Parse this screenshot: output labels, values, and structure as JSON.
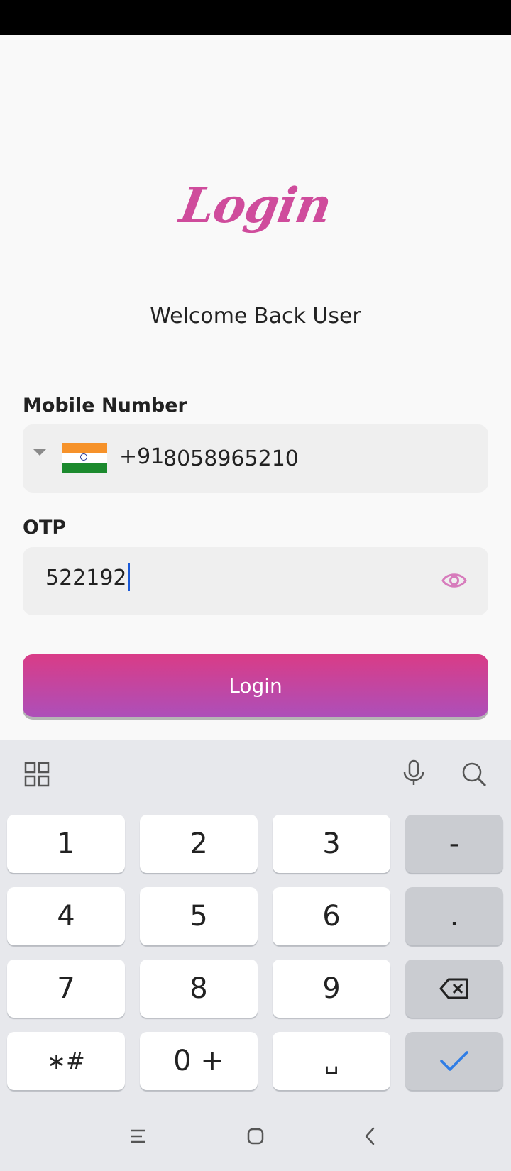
{
  "header": {
    "title": "Login",
    "subtitle": "Welcome Back User"
  },
  "mobile": {
    "label": "Mobile Number",
    "dial_code": "+91",
    "value": "8058965210",
    "country_flag_icon": "india-flag-icon"
  },
  "otp": {
    "label": "OTP",
    "value": "522192",
    "visibility_icon": "eye-icon"
  },
  "login_button": {
    "label": "Login"
  },
  "colors": {
    "accent": "#cf4c9c",
    "button_gradient_top": "#d93c87",
    "button_gradient_bottom": "#ad4fb9"
  },
  "keyboard": {
    "toolbar_icons": [
      "apps-grid-icon",
      "microphone-icon",
      "search-icon"
    ],
    "keys": {
      "k1": "1",
      "k2": "2",
      "k3": "3",
      "minus": "-",
      "k4": "4",
      "k5": "5",
      "k6": "6",
      "period": ".",
      "k7": "7",
      "k8": "8",
      "k9": "9",
      "star_hash": "∗#",
      "zero_plus": "0 +",
      "space": "␣"
    },
    "action_icons": [
      "backspace-icon",
      "done-check-icon"
    ]
  },
  "navigation": [
    "recents-icon",
    "home-icon",
    "back-icon"
  ]
}
